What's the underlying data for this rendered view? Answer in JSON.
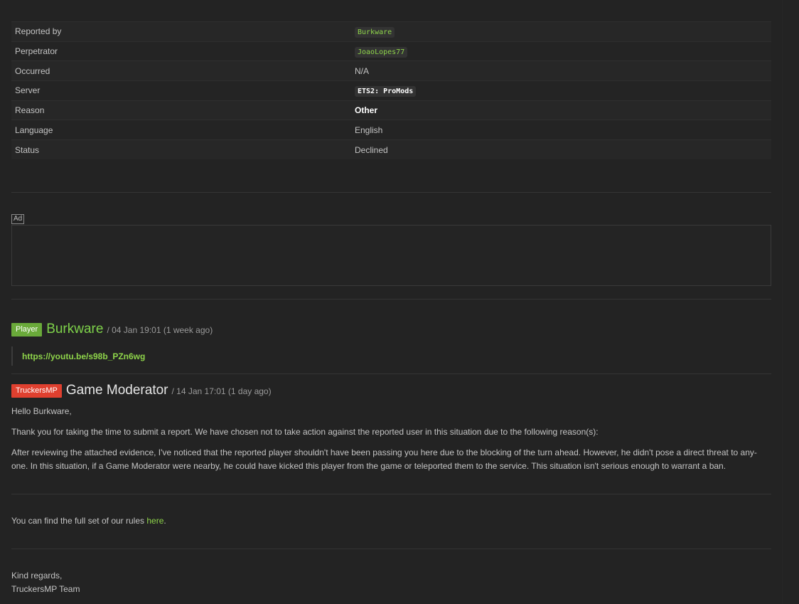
{
  "report": {
    "rows": [
      {
        "label": "Reported by",
        "value": "Burkware"
      },
      {
        "label": "Perpetrator",
        "value": "JoaoLopes77"
      },
      {
        "label": "Occurred",
        "value": "N/A"
      },
      {
        "label": "Server",
        "value": "ETS2: ProMods"
      },
      {
        "label": "Reason",
        "value": "Other"
      },
      {
        "label": "Language",
        "value": "English"
      },
      {
        "label": "Status",
        "value": "Declined"
      }
    ]
  },
  "ad": {
    "label": "Ad"
  },
  "comments": [
    {
      "badge": "Player",
      "author": "Burkware",
      "meta": "/ 04 Jan 19:01 (1 week ago)",
      "link": "https://youtu.be/s98b_PZn6wg"
    },
    {
      "badge": "TruckersMP",
      "author": "Game Moderator",
      "meta": "/ 14 Jan 17:01 (1 day ago)",
      "greeting": "Hello Burkware,",
      "intro": "Thank you for taking the time to submit a report. We have chosen not to take action against the reported user in this situation due to the following reason(s):",
      "reason_line1": "After reviewing the attached evidence, I've noticed that the reported player shouldn't have been passing you here due to the blocking of the turn ahead. However, he didn't pose a direct threat to any-",
      "reason_line2": "one. In this situation, if a Game Moderator were nearby, he could have kicked this player from the game or teleported them to the service. This situation isn't serious enough to warrant a ban.",
      "rules_text": "You can find the full set of our rules ",
      "rules_link": "here",
      "rules_end": ".",
      "regards": "Kind regards,",
      "team": "TruckersMP Team"
    }
  ],
  "colors": {
    "background": "#232323",
    "accent_green": "#8ed44a",
    "badge_player": "#6aaa3a",
    "badge_truckersmp": "#e0402f"
  }
}
